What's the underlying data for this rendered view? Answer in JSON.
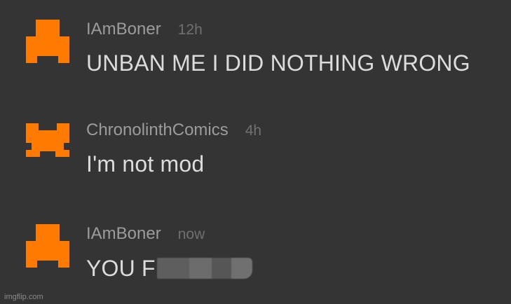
{
  "comments": [
    {
      "username": "IAmBoner",
      "timestamp": "12h",
      "text": "UNBAN ME I DID NOTHING WRONG",
      "avatar_icon": "orange-block-figure-icon",
      "avatar_color": "#ff7a00"
    },
    {
      "username": "ChronolinthComics",
      "timestamp": "4h",
      "text": "I'm not mod",
      "avatar_icon": "orange-block-creature-icon",
      "avatar_color": "#ff7a00"
    },
    {
      "username": "IAmBoner",
      "timestamp": "now",
      "text": "YOU F",
      "censored": true,
      "avatar_icon": "orange-block-figure-icon",
      "avatar_color": "#ff7a00"
    }
  ],
  "watermark": "imgflip.com",
  "colors": {
    "background": "#343434",
    "username": "#9c9c9c",
    "timestamp": "#707070",
    "text": "#dcdcdc",
    "accent": "#ff7a00"
  }
}
